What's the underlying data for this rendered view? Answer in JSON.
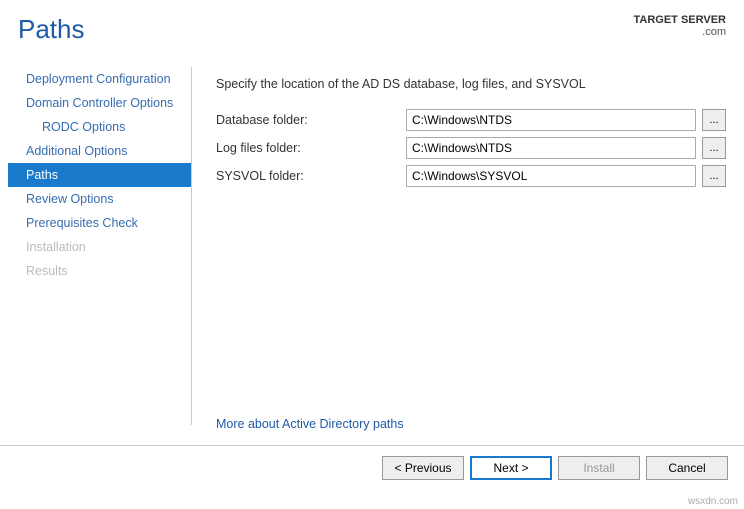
{
  "header": {
    "title": "Paths",
    "target_label": "TARGET SERVER",
    "target_server": ".com"
  },
  "sidebar": {
    "items": [
      {
        "label": "Deployment Configuration"
      },
      {
        "label": "Domain Controller Options"
      },
      {
        "label": "RODC Options"
      },
      {
        "label": "Additional Options"
      },
      {
        "label": "Paths"
      },
      {
        "label": "Review Options"
      },
      {
        "label": "Prerequisites Check"
      },
      {
        "label": "Installation"
      },
      {
        "label": "Results"
      }
    ]
  },
  "main": {
    "description": "Specify the location of the AD DS database, log files, and SYSVOL",
    "rows": [
      {
        "label": "Database folder:",
        "value": "C:\\Windows\\NTDS",
        "browse": "..."
      },
      {
        "label": "Log files folder:",
        "value": "C:\\Windows\\NTDS",
        "browse": "..."
      },
      {
        "label": "SYSVOL folder:",
        "value": "C:\\Windows\\SYSVOL",
        "browse": "..."
      }
    ],
    "more_link": "More about Active Directory paths"
  },
  "footer": {
    "previous": "< Previous",
    "next": "Next >",
    "install": "Install",
    "cancel": "Cancel"
  },
  "watermark": "wsxdn.com"
}
